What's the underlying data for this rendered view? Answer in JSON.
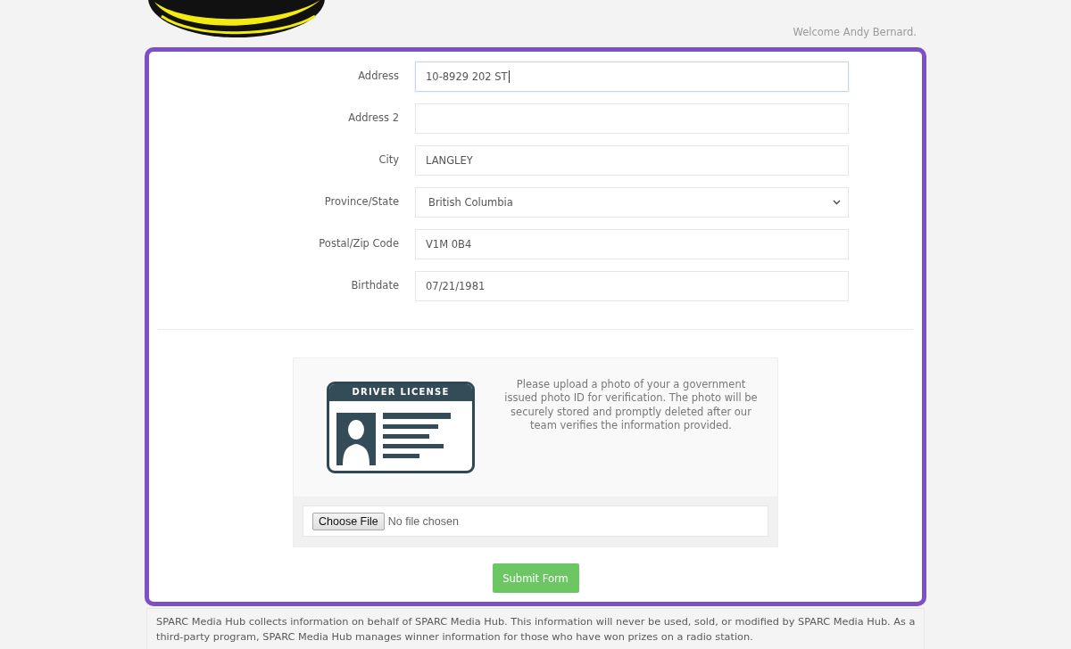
{
  "header": {
    "welcome": "Welcome Andy Bernard."
  },
  "form": {
    "fields": [
      {
        "label": "Address",
        "kind": "text",
        "value": "10-8929 202 ST",
        "focused": true
      },
      {
        "label": "Address 2",
        "kind": "text",
        "focused": false
      },
      {
        "label": "City",
        "kind": "text",
        "value": "LANGLEY",
        "focused": false
      },
      {
        "label": "Province/State",
        "kind": "select",
        "value": "British Columbia",
        "focused": false
      },
      {
        "label": "Postal/Zip Code",
        "kind": "text",
        "value": "V1M 0B4",
        "focused": false
      },
      {
        "label": "Birthdate",
        "kind": "text",
        "value": "07/21/1981",
        "focused": false
      }
    ]
  },
  "upload": {
    "card_title": "DRIVER LICENSE",
    "message": "Please upload a photo of your a government issued photo ID for verification. The photo will be securely stored and promptly deleted after our team verifies the information provided.",
    "file_button": "Choose File",
    "file_status": "No file chosen"
  },
  "submit": "Submit Form",
  "footer": "SPARC Media Hub collects information on behalf of SPARC Media Hub. This information will never be used, sold, or modified by SPARC Media Hub. As a third-party program, SPARC Media Hub manages winner information for those who have won prizes on a radio station."
}
